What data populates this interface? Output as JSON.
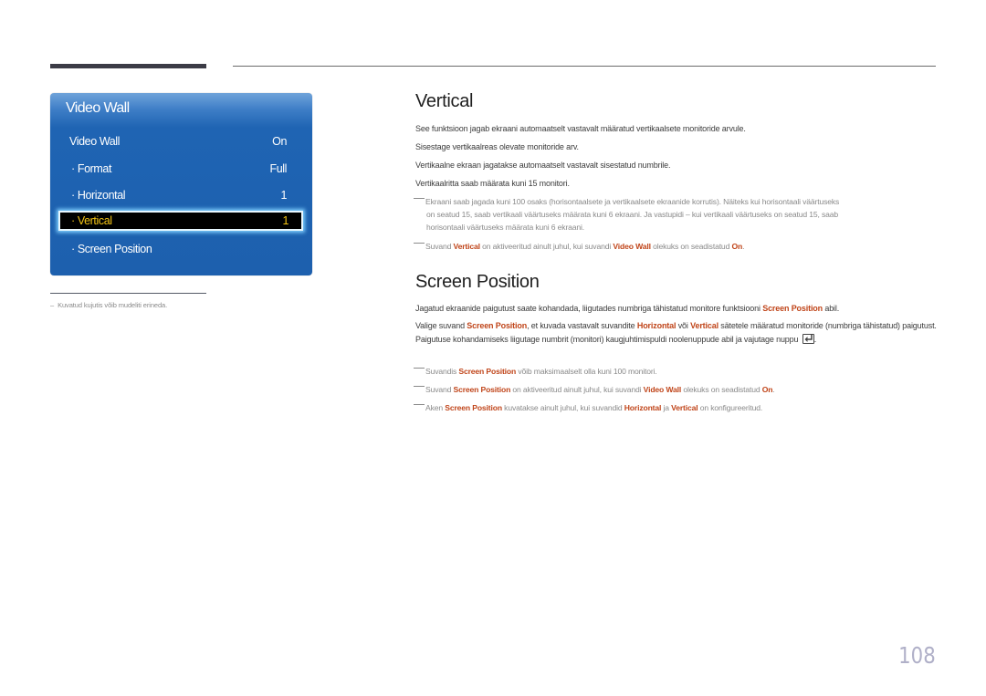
{
  "osd": {
    "title": "Video Wall",
    "rows": [
      {
        "label": "Video Wall",
        "value": "On"
      },
      {
        "label": "Format",
        "value": "Full"
      },
      {
        "label": "Horizontal",
        "value": "1"
      },
      {
        "label": "Vertical",
        "value": "1",
        "selected": true
      },
      {
        "label": "Screen Position",
        "value": ""
      }
    ],
    "colors": {
      "panel": "#1f64b3",
      "selected_text": "#f2c315",
      "selected_bg": "#000000"
    }
  },
  "left_note": {
    "dash": "–",
    "text": "Kuvatud kujutis võib mudeliti erineda."
  },
  "vertical": {
    "heading": "Vertical",
    "paragraphs": [
      "See funktsioon jagab ekraani automaatselt vastavalt määratud vertikaalsete monitoride arvule.",
      "Sisestage vertikaalreas olevate monitoride arv.",
      "Vertikaalne ekraan jagatakse automaatselt vastavalt sisestatud numbrile.",
      "Vertikaalritta saab määrata kuni 15 monitori."
    ],
    "notes": {
      "note1_line1": "Ekraani saab jagada kuni 100 osaks (horisontaalsete ja vertikaalsete ekraanide korrutis). Näiteks kui horisontaali väärtuseks",
      "note1_line2": "on seatud 15, saab vertikaali väärtuseks määrata kuni 6 ekraani. Ja vastupidi – kui vertikaali väärtuseks on seatud 15, saab",
      "note1_line3": "horisontaali väärtuseks määrata kuni 6 ekraani.",
      "note2_a": "Suvand ",
      "note2_hl1": "Vertical",
      "note2_b": " on aktiveeritud ainult juhul, kui suvandi ",
      "note2_hl2": "Video Wall",
      "note2_c": " olekuks on seadistatud ",
      "note2_hl3": "On",
      "note2_d": "."
    }
  },
  "screen_position": {
    "heading": "Screen Position",
    "p1_a": "Jagatud ekraanide paigutust saate kohandada, liigutades numbriga tähistatud monitore funktsiooni ",
    "p1_hl": "Screen Position",
    "p1_b": " abil.",
    "p2_a": "Valige suvand ",
    "p2_hl1": "Screen Position",
    "p2_b": ", et kuvada vastavalt suvandite ",
    "p2_hl2": "Horizontal",
    "p2_c": " või ",
    "p2_hl3": "Vertical",
    "p2_d": " sätetele määratud monitoride (numbriga tähistatud) paigutust. Paigutuse kohandamiseks liigutage numbrit (monitori) kaugjuhtimispuldi noolenuppude abil ja vajutage nuppu",
    "p2_e": ".",
    "enter_icon": "enter-icon",
    "notes": {
      "n1_a": "Suvandis ",
      "n1_hl": "Screen Position",
      "n1_b": " võib maksimaalselt olla kuni 100 monitori.",
      "n2_a": "Suvand ",
      "n2_hl1": "Screen Position",
      "n2_b": " on aktiveeritud ainult juhul, kui suvandi ",
      "n2_hl2": "Video Wall",
      "n2_c": " olekuks on seadistatud ",
      "n2_hl3": "On",
      "n2_d": ".",
      "n3_a": "Aken ",
      "n3_hl1": "Screen Position",
      "n3_b": " kuvatakse ainult juhul, kui suvandid ",
      "n3_hl2": "Horizontal",
      "n3_c": " ja ",
      "n3_hl3": "Vertical",
      "n3_d": " on konfigureeritud."
    }
  },
  "page_number": "108",
  "colors": {
    "highlight": "#c0451a",
    "note_text": "#8a8a8a",
    "page_number": "#b0b0c8"
  }
}
